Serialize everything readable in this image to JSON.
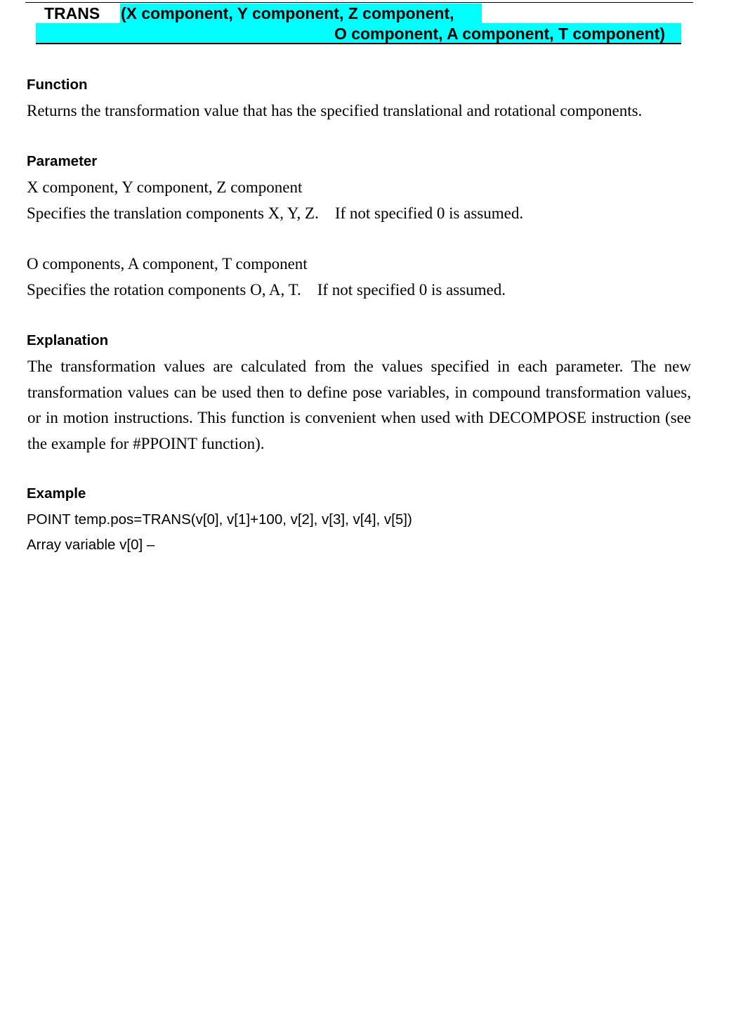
{
  "header": {
    "keyword": "TRANS",
    "signature_line1": "(X component, Y component, Z component,",
    "signature_line2": "O component, A component, T component)",
    "highlight_color": "#00ffff"
  },
  "function": {
    "heading": "Function",
    "text": "Returns the transformation value that has the specified translational and rotational components."
  },
  "parameter": {
    "heading": "Parameter",
    "translation_name": "X component, Y component, Z component",
    "translation_desc": "Specifies the translation components X, Y, Z.    If not specified 0 is assumed.",
    "rotation_name": "O components, A component, T component",
    "rotation_desc": "Specifies the rotation components O, A, T.    If not specified 0 is assumed."
  },
  "explanation": {
    "heading": "Explanation",
    "text": "The transformation values are calculated from the values specified in each parameter.     The new transformation values can be used then to define pose variables, in compound transformation values, or in motion instructions.    This function is convenient when used with DECOMPOSE instruction (see the example for #PPOINT function)."
  },
  "example": {
    "heading": "Example",
    "code": "POINT temp.pos=TRANS(v[0], v[1]+100, v[2], v[3], v[4], v[5])",
    "note": "Array variable v[0] –"
  }
}
